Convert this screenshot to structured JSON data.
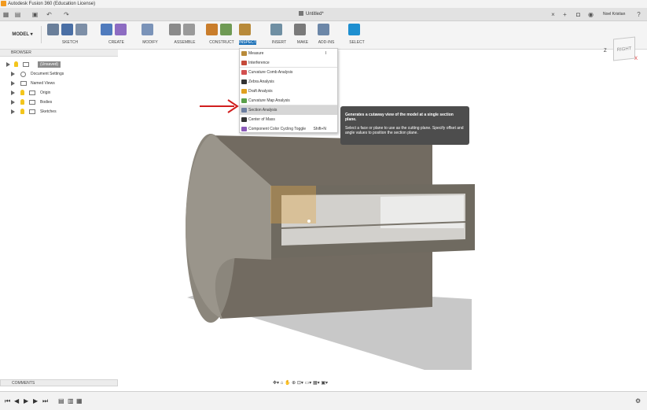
{
  "window": {
    "title": "Autodesk Fusion 360 (Education License)"
  },
  "document": {
    "tab_title": "Untitled*"
  },
  "user": {
    "name": "Noel Kristian"
  },
  "toolbar": {
    "workspace": "MODEL",
    "groups": [
      {
        "label": "SKETCH",
        "colors": [
          "#6a7f9a",
          "#4a6fa5",
          "#7d8fa7"
        ]
      },
      {
        "label": "CREATE",
        "colors": [
          "#4f7bbd",
          "#8d6cc2"
        ]
      },
      {
        "label": "MODIFY",
        "colors": [
          "#7a93b8"
        ]
      },
      {
        "label": "ASSEMBLE",
        "colors": [
          "#8a8a8a",
          "#9a9a9a"
        ]
      },
      {
        "label": "CONSTRUCT",
        "colors": [
          "#c97d2b",
          "#6f9a54"
        ]
      },
      {
        "label": "INSPECT",
        "colors": [
          "#b88a3a"
        ]
      },
      {
        "label": "INSERT",
        "colors": [
          "#6f8fa3"
        ]
      },
      {
        "label": "MAKE",
        "colors": [
          "#7a7a7a"
        ]
      },
      {
        "label": "ADD-INS",
        "colors": [
          "#6c87a8"
        ]
      },
      {
        "label": "SELECT",
        "colors": [
          "#1e8fd0"
        ]
      }
    ]
  },
  "viewcube": {
    "face": "RIGHT",
    "axis_z": "Z",
    "axis_x": "X"
  },
  "browser": {
    "title": "BROWSER",
    "root": "(Unsaved)",
    "items": [
      {
        "label": "Document Settings"
      },
      {
        "label": "Named Views"
      },
      {
        "label": "Origin"
      },
      {
        "label": "Bodies"
      },
      {
        "label": "Sketches"
      }
    ]
  },
  "inspect_menu": {
    "items": [
      {
        "label": "Measure",
        "shortcut": "I",
        "color": "#b88a3a"
      },
      {
        "label": "Interference",
        "shortcut": "",
        "color": "#c54a3a"
      },
      {
        "label": "Curvature Comb Analysis",
        "shortcut": "",
        "color": "#d24f4f"
      },
      {
        "label": "Zebra Analysis",
        "shortcut": "",
        "color": "#333333"
      },
      {
        "label": "Draft Analysis",
        "shortcut": "",
        "color": "#e0a020"
      },
      {
        "label": "Curvature Map Analysis",
        "shortcut": "",
        "color": "#5aa04a"
      },
      {
        "label": "Section Analysis",
        "shortcut": "",
        "color": "#6d7fa0"
      },
      {
        "label": "Center of Mass",
        "shortcut": "",
        "color": "#333333"
      },
      {
        "label": "Component Color Cycling Toggle",
        "shortcut": "Shift+N",
        "color": "#8a5ab8"
      }
    ]
  },
  "tooltip": {
    "heading": "Generates a cutaway view of the model at a single section plane.",
    "body": "Select a face or plane to use as the cutting plane. Specify offset and angle values to position the section plane."
  },
  "comments": {
    "title": "COMMENTS"
  },
  "colors": {
    "accent": "#1e72b8",
    "highlight": "#d6d6d6",
    "annotation_arrow": "#d11e1e"
  }
}
